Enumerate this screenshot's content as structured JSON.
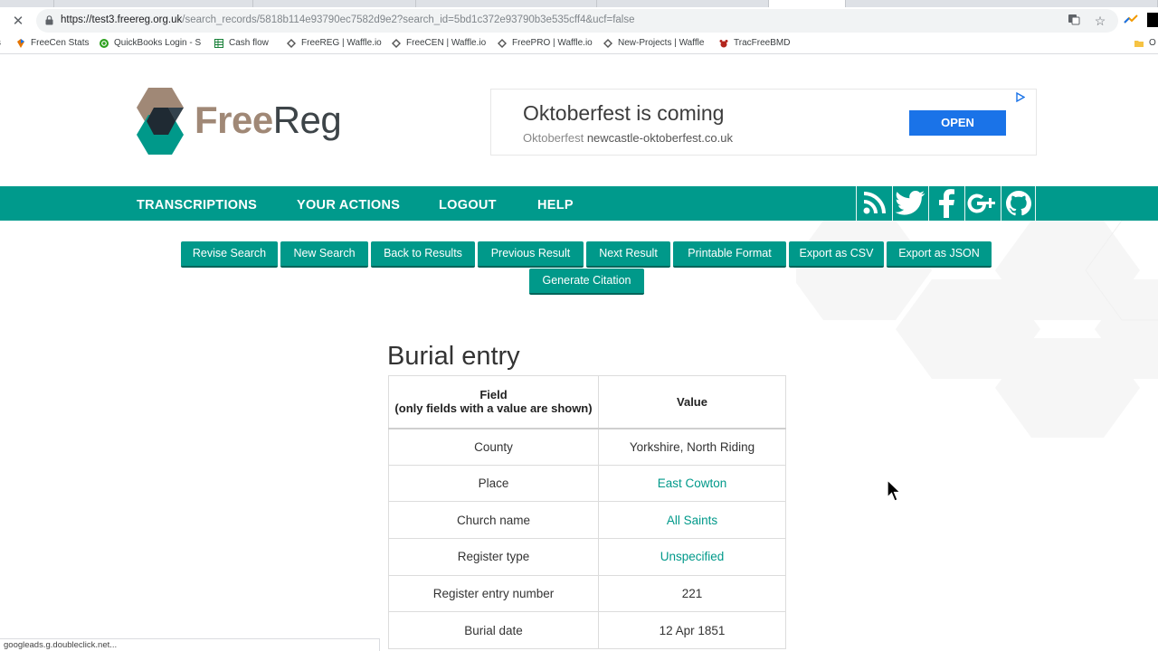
{
  "browser": {
    "url_host": "https://test3.freereg.org.uk",
    "url_path": "/search_records/5818b114e93790ec7582d9e2?search_id=5bd1c372e93790b3e535cff4&ucf=false",
    "bookmarks": [
      {
        "label": "FreeCen Stats"
      },
      {
        "label": "QuickBooks Login - S"
      },
      {
        "label": "Cash flow"
      },
      {
        "label": "FreeREG | Waffle.io"
      },
      {
        "label": "FreeCEN | Waffle.io"
      },
      {
        "label": "FreePRO | Waffle.io"
      },
      {
        "label": "New-Projects | Waffle"
      },
      {
        "label": "TracFreeBMD"
      },
      {
        "label": "O"
      }
    ],
    "status_text": "googleads.g.doubleclick.net..."
  },
  "logo": {
    "free": "Free",
    "reg": "Reg"
  },
  "ad": {
    "headline": "Oktoberfest is coming",
    "sub_label": "Oktoberfest",
    "sub_host": "newcastle-oktoberfest.co.uk",
    "button": "OPEN"
  },
  "nav": {
    "items": [
      "TRANSCRIPTIONS",
      "YOUR ACTIONS",
      "LOGOUT",
      "HELP"
    ],
    "social": [
      "rss-icon",
      "twitter-icon",
      "facebook-icon",
      "google-plus-icon",
      "github-icon"
    ]
  },
  "actions": [
    "Revise Search",
    "New Search",
    "Back to Results",
    "Previous Result",
    "Next Result",
    "Printable Format",
    "Export as CSV",
    "Export as JSON",
    "Generate Citation"
  ],
  "record": {
    "title": "Burial entry",
    "header_field_line1": "Field",
    "header_field_line2": "(only fields with a value are shown)",
    "header_value": "Value",
    "rows": [
      {
        "field": "County",
        "value": "Yorkshire, North Riding",
        "link": false
      },
      {
        "field": "Place",
        "value": "East Cowton",
        "link": true
      },
      {
        "field": "Church name",
        "value": "All Saints",
        "link": true
      },
      {
        "field": "Register type",
        "value": "Unspecified",
        "link": true
      },
      {
        "field": "Register entry number",
        "value": "221",
        "link": false
      },
      {
        "field": "Burial date",
        "value": "12 Apr 1851",
        "link": false
      }
    ]
  },
  "colors": {
    "teal": "#009a8c",
    "teal_dark": "#00645a",
    "brand_brown": "#a08876",
    "ad_blue": "#1a73e8"
  }
}
